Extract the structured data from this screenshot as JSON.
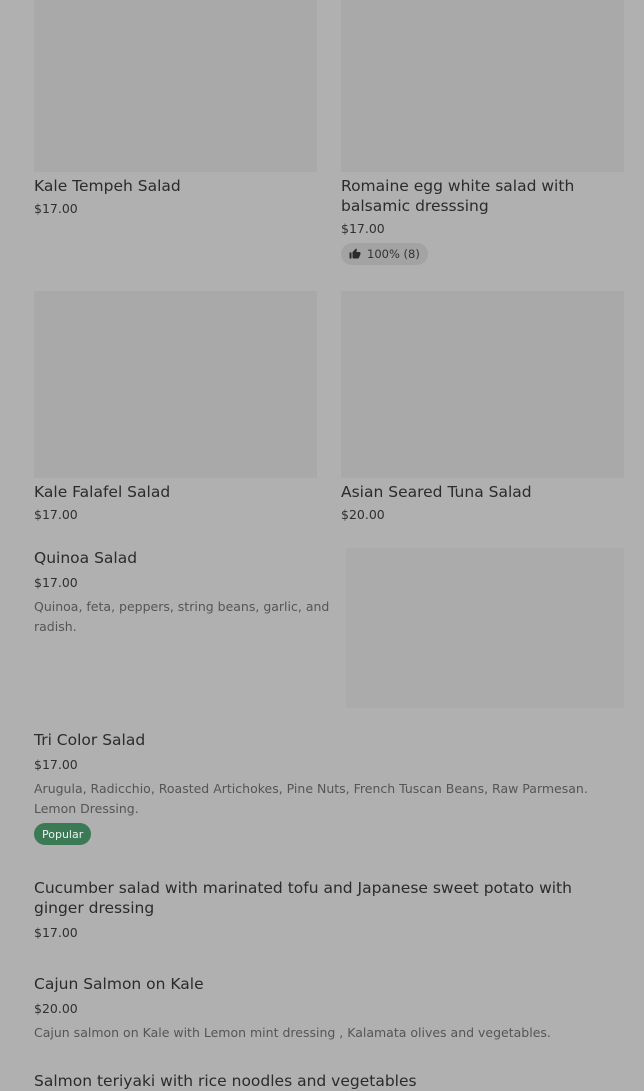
{
  "grid_items": [
    {
      "name": "Kale Tempeh Salad",
      "price": "$17.00"
    },
    {
      "name": "Romaine egg white salad with balsamic dresssing",
      "price": "$17.00",
      "rating": "100% (8)"
    },
    {
      "name": "Kale Falafel Salad",
      "price": "$17.00"
    },
    {
      "name": "Asian Seared Tuna Salad",
      "price": "$20.00"
    }
  ],
  "list_items": [
    {
      "name": "Quinoa Salad",
      "price": "$17.00",
      "desc": "Quinoa, feta, peppers, string beans, garlic, and radish."
    },
    {
      "name": "Tri Color Salad",
      "price": "$17.00",
      "desc": "Arugula, Radicchio, Roasted Artichokes, Pine Nuts, French Tuscan Beans, Raw Parmesan. Lemon Dressing.",
      "badge": "Popular"
    },
    {
      "name": "Cucumber salad with marinated tofu and Japanese sweet potato with ginger dressing",
      "price": "$17.00"
    },
    {
      "name": "Cajun Salmon on Kale",
      "price": "$20.00",
      "desc": "Cajun salmon on Kale with Lemon mint dressing , Kalamata olives and vegetables."
    },
    {
      "name": "Salmon teriyaki with rice noodles and vegetables"
    }
  ],
  "colors": {
    "background": "#b0b0b0",
    "popular_badge": "#3b7a55"
  },
  "icons": {
    "rating": "thumbs-up-icon"
  }
}
